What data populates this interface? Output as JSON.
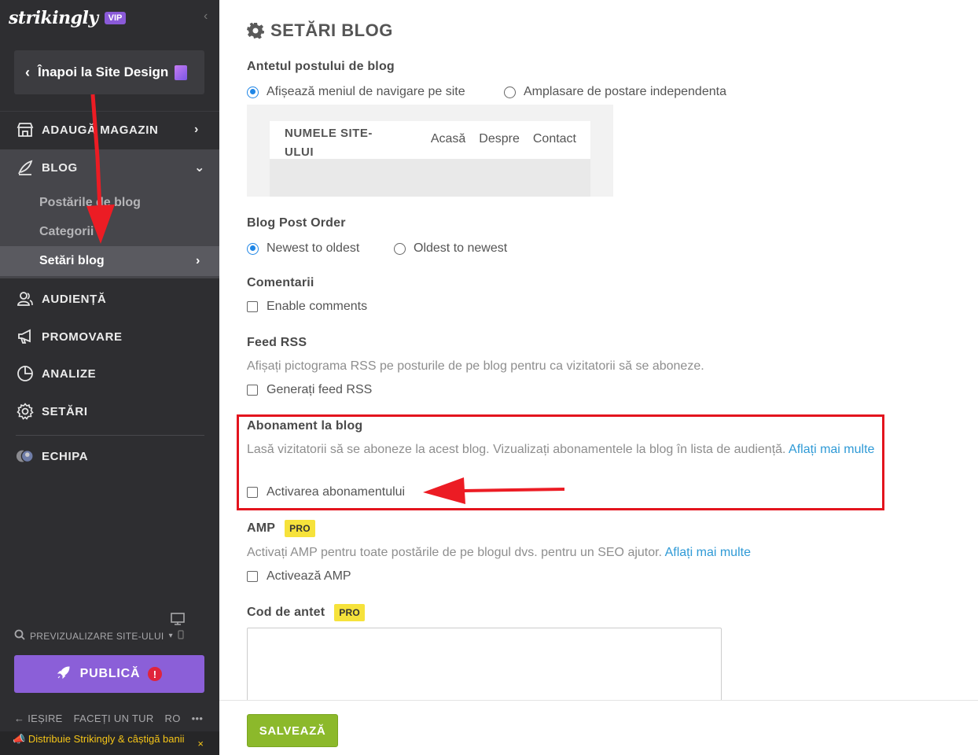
{
  "sidebar": {
    "logo": "strikingly",
    "vip_badge": "VIP",
    "collapse_icon": "chevron-left-icon",
    "back_button": "Înapoi la Site Design",
    "nav": {
      "add_store": "ADAUGĂ MAGAZIN",
      "blog": "BLOG",
      "blog_sub": {
        "posts": "Postările de blog",
        "categories": "Categorii",
        "settings": "Setări blog"
      },
      "audience": "AUDIENȚĂ",
      "promote": "PROMOVARE",
      "analytics": "ANALIZE",
      "settings": "SETĂRI",
      "team": "ECHIPA"
    },
    "preview": "PREVIZUALIZARE SITE-ULUI",
    "publish": "PUBLICĂ",
    "publish_warning": "!",
    "bottom_links": {
      "exit": "IEȘIRE",
      "tour": "FACEȚI UN TUR",
      "lang": "RO",
      "more": "•••"
    },
    "promo": "Distribuie Strikingly & câștigă banii",
    "promo_close": "×"
  },
  "main": {
    "title": "SETĂRI BLOG",
    "header_section": {
      "title": "Antetul postului de blog",
      "option_nav": "Afișează meniul de navigare pe site",
      "option_standalone": "Amplasare de postare independenta",
      "selected": "option_nav",
      "preview": {
        "site_name": "NUMELE SITE-ULUI",
        "nav_items": [
          "Acasă",
          "Despre",
          "Contact"
        ]
      }
    },
    "order_section": {
      "title": "Blog Post Order",
      "option_newest": "Newest to oldest",
      "option_oldest": "Oldest to newest",
      "selected": "option_newest"
    },
    "comments_section": {
      "title": "Comentarii",
      "checkbox": "Enable comments",
      "checked": false
    },
    "rss_section": {
      "title": "Feed RSS",
      "description": "Afișați pictograma RSS pe posturile de pe blog pentru ca vizitatorii să se aboneze.",
      "checkbox": "Generați feed RSS",
      "checked": false
    },
    "subscription_section": {
      "title": "Abonament la blog",
      "description": "Lasă vizitatorii să se aboneze la acest blog. Vizualizați abonamentele la blog în lista de audiență.",
      "link": "Aflați mai multe",
      "checkbox": "Activarea abonamentului",
      "checked": false
    },
    "amp_section": {
      "title": "AMP",
      "badge": "PRO",
      "description": "Activați AMP pentru toate postările de pe blogul dvs. pentru un SEO ajutor.",
      "link": "Aflați mai multe",
      "checkbox": "Activează AMP",
      "checked": false
    },
    "header_code_section": {
      "title": "Cod de antet",
      "badge": "PRO",
      "value": ""
    },
    "save_button": "SALVEAZĂ"
  },
  "colors": {
    "sidebar_bg": "#2e2e31",
    "accent_purple": "#8b5fd8",
    "save_green": "#8cb92b",
    "radio_blue": "#1f86e6",
    "link_blue": "#2f9ad6",
    "pro_yellow": "#f6e23b",
    "annotation_red": "#e3141e"
  }
}
